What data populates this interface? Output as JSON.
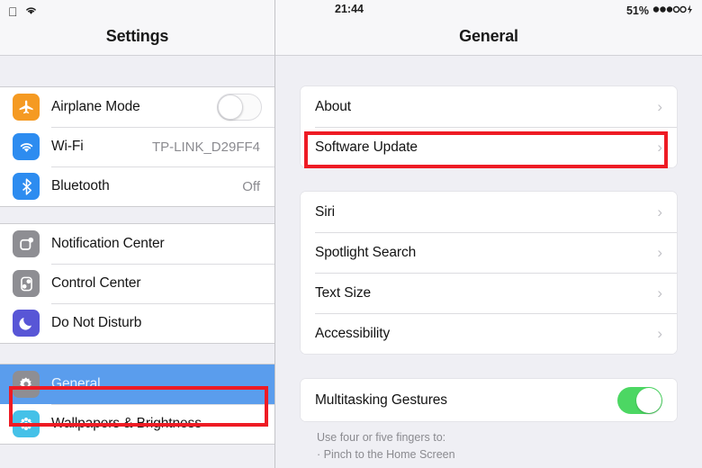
{
  "status_bar": {
    "apple_logo": "apple-logo-icon",
    "wifi_icon": "wifi-signal-icon",
    "time": "21:44",
    "battery_percent": "51%",
    "battery_icon": "battery-indicator-icon"
  },
  "sidebar": {
    "title": "Settings",
    "groups": [
      {
        "items": [
          {
            "label": "Airplane Mode",
            "icon": "airplane-icon",
            "icon_color": "#f59a22",
            "control": "toggle",
            "toggle_on": false
          },
          {
            "label": "Wi-Fi",
            "icon": "wifi-icon",
            "icon_color": "#2d8cf0",
            "control": "value",
            "value": "TP-LINK_D29FF4"
          },
          {
            "label": "Bluetooth",
            "icon": "bluetooth-icon",
            "icon_color": "#2d8cf0",
            "control": "value",
            "value": "Off"
          }
        ]
      },
      {
        "items": [
          {
            "label": "Notification Center",
            "icon": "notification-center-icon",
            "icon_color": "#8e8e93",
            "control": "none"
          },
          {
            "label": "Control Center",
            "icon": "control-center-icon",
            "icon_color": "#8e8e93",
            "control": "none"
          },
          {
            "label": "Do Not Disturb",
            "icon": "moon-icon",
            "icon_color": "#5856d6",
            "control": "none"
          }
        ]
      },
      {
        "items": [
          {
            "label": "General",
            "icon": "gear-icon",
            "icon_color": "#8e8e93",
            "control": "none",
            "selected": true
          },
          {
            "label": "Wallpapers & Brightness",
            "icon": "wallpaper-flower-icon",
            "icon_color": "#45c1e8",
            "control": "none"
          }
        ]
      }
    ],
    "selected_item": "General",
    "selection_color": "#5a9ded"
  },
  "detail": {
    "title": "General",
    "groups": [
      {
        "rows": [
          {
            "label": "About",
            "accessory": "chevron-right-icon"
          },
          {
            "label": "Software Update",
            "accessory": "chevron-right-icon",
            "annotated": true
          }
        ]
      },
      {
        "rows": [
          {
            "label": "Siri",
            "accessory": "chevron-right-icon"
          },
          {
            "label": "Spotlight Search",
            "accessory": "chevron-right-icon"
          },
          {
            "label": "Text Size",
            "accessory": "chevron-right-icon"
          },
          {
            "label": "Accessibility",
            "accessory": "chevron-right-icon"
          }
        ]
      },
      {
        "rows": [
          {
            "label": "Multitasking Gestures",
            "accessory": "toggle",
            "toggle_on": true
          }
        ],
        "footer_lines": [
          "Use four or five fingers to:",
          "· Pinch to the Home Screen"
        ]
      }
    ]
  },
  "annotations": {
    "highlight_color": "#ee1b24",
    "boxes": [
      {
        "target": "software-update-row"
      },
      {
        "target": "sidebar-item-general"
      }
    ]
  }
}
